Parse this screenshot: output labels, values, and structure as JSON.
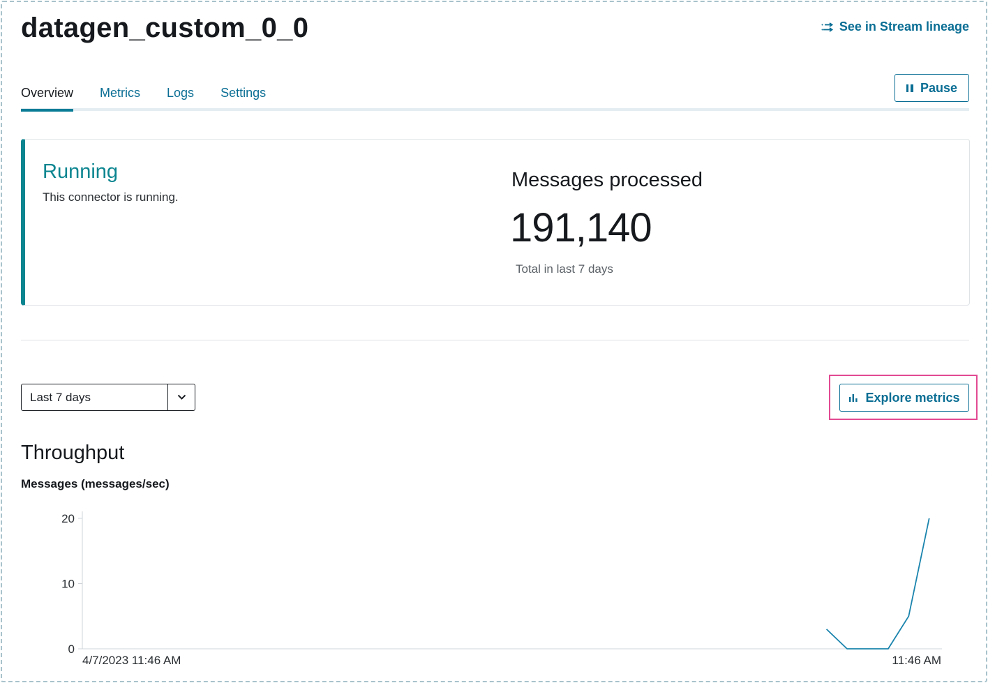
{
  "header": {
    "title": "datagen_custom_0_0",
    "lineage_link": "See in Stream lineage"
  },
  "tabs": [
    {
      "label": "Overview",
      "active": true
    },
    {
      "label": "Metrics",
      "active": false
    },
    {
      "label": "Logs",
      "active": false
    },
    {
      "label": "Settings",
      "active": false
    }
  ],
  "actions": {
    "pause_label": "Pause",
    "explore_label": "Explore metrics"
  },
  "status": {
    "title": "Running",
    "description": "This connector is running."
  },
  "metrics": {
    "title": "Messages processed",
    "value": "191,140",
    "subtitle": "Total in last 7 days"
  },
  "time_range": {
    "selected": "Last 7 days"
  },
  "throughput": {
    "title": "Throughput",
    "ylabel": "Messages (messages/sec)"
  },
  "colors": {
    "accent": "#0a6e94",
    "running": "#0b8590",
    "highlight": "#e24a93"
  },
  "icons": {
    "lineage": "lineage-arrows-icon",
    "pause": "pause-icon",
    "explore": "bar-chart-icon",
    "dropdown": "chevron-down-icon"
  },
  "chart_data": {
    "type": "line",
    "title": "Throughput",
    "ylabel": "Messages (messages/sec)",
    "xlabel": "",
    "x_tick_labels": [
      "4/7/2023 11:46 AM",
      "11:46 AM"
    ],
    "y_ticks": [
      0,
      10,
      20
    ],
    "ylim": [
      0,
      20
    ],
    "xlim": [
      0,
      1
    ],
    "grid": false,
    "series": [
      {
        "color": "#1a84ad",
        "x": [
          0.87,
          0.894,
          0.918,
          0.942,
          0.966,
          0.99
        ],
        "y": [
          3,
          0,
          0,
          0,
          5,
          20
        ]
      }
    ]
  }
}
